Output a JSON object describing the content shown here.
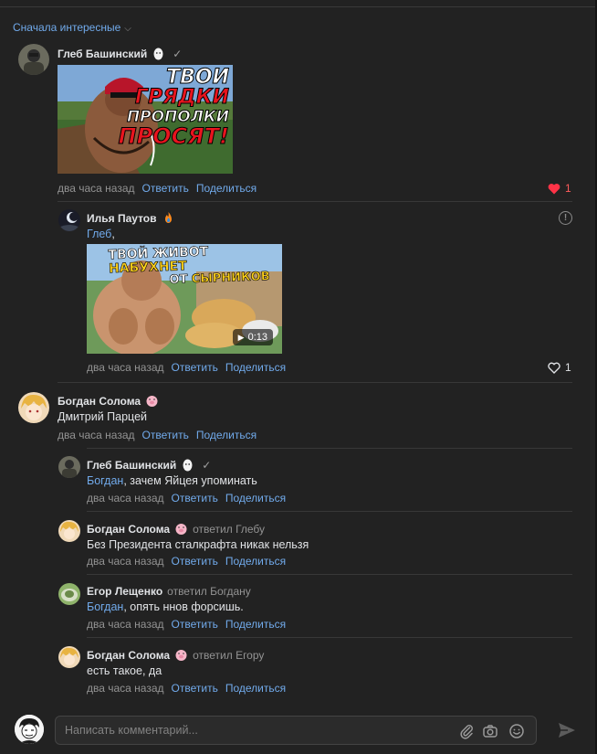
{
  "sort": {
    "label": "Сначала интересные"
  },
  "comments": [
    {
      "author": "Глеб Башинский",
      "time": "два часа назад",
      "reply_label": "Ответить",
      "share_label": "Поделиться",
      "likes": "1",
      "thumbnail": {
        "line1": "ТВОИ",
        "line2": "ГРЯДКИ",
        "line3": "ПРОПОЛКИ",
        "line4": "ПРОСЯТ!"
      }
    },
    {
      "author": "Илья Паутов",
      "mention": "Глеб",
      "text_rest": ",",
      "time": "два часа назад",
      "reply_label": "Ответить",
      "share_label": "Поделиться",
      "likes": "1",
      "video": {
        "line1": "ТВОЙ ЖИВОТ",
        "line1b": "НАБУХНЕТ",
        "line2": "ОТ",
        "line2b": "СЫРНИКОВ",
        "duration": "0:13"
      }
    },
    {
      "author": "Богдан Солома",
      "text": "Дмитрий Парцей",
      "time": "два часа назад",
      "reply_label": "Ответить",
      "share_label": "Поделиться"
    },
    {
      "author": "Глеб Башинский",
      "mention": "Богдан",
      "text_rest": ", зачем Яйцея упоминать",
      "time": "два часа назад",
      "reply_label": "Ответить",
      "share_label": "Поделиться"
    },
    {
      "author": "Богдан Солома",
      "replied_to": "ответил Глебу",
      "text": "Без Президента сталкрафта никак нельзя",
      "time": "два часа назад",
      "reply_label": "Ответить",
      "share_label": "Поделиться"
    },
    {
      "author": "Егор Лещенко",
      "replied_to": "ответил Богдану",
      "mention": "Богдан",
      "text_rest": ", опять ннов форсишь.",
      "time": "два часа назад",
      "reply_label": "Ответить",
      "share_label": "Поделиться"
    },
    {
      "author": "Богдан Солома",
      "replied_to": "ответил Егору",
      "text": "есть такое, да",
      "time": "два часа назад",
      "reply_label": "Ответить",
      "share_label": "Поделиться"
    }
  ],
  "composer": {
    "placeholder": "Написать комментарий..."
  },
  "colors": {
    "accent": "#71aaeb",
    "like_red": "#ff5c5c",
    "background": "#222222"
  }
}
